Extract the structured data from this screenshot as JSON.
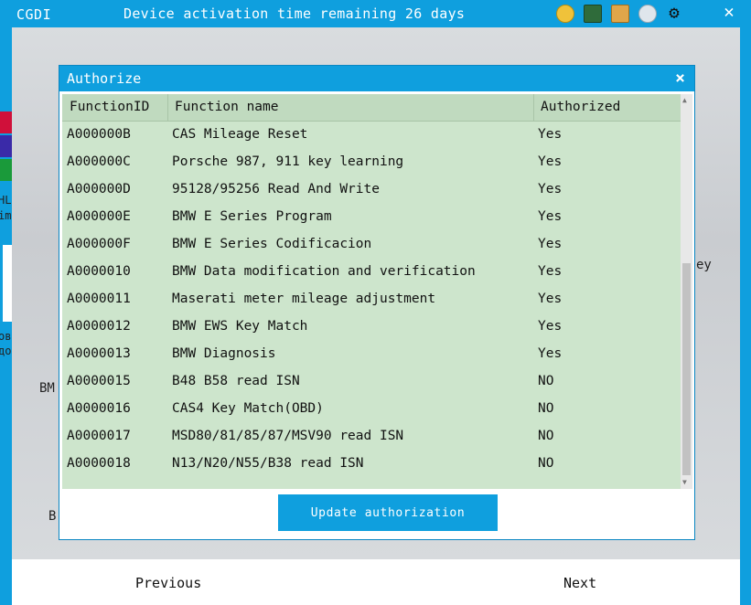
{
  "app": {
    "title": "CGDI",
    "activation_notice": "Device activation time remaining 26 days",
    "icons": [
      "coin-icon",
      "book-icon",
      "folder-icon",
      "handshake-icon",
      "gear-icon",
      "close-icon"
    ]
  },
  "background": {
    "fragments": {
      "left1": "HL",
      "left2": "im",
      "left3": "овы",
      "left4": "до",
      "bmw_fragment": "BM",
      "b_fragment": "B",
      "right_fragment": "ey"
    }
  },
  "dialog": {
    "title": "Authorize",
    "close_glyph": "×",
    "columns": [
      "FunctionID",
      "Function name",
      "Authorized"
    ],
    "rows": [
      {
        "id": "A000000B",
        "name": "CAS Mileage Reset",
        "authorized": "Yes"
      },
      {
        "id": "A000000C",
        "name": "Porsche 987, 911 key learning",
        "authorized": "Yes"
      },
      {
        "id": "A000000D",
        "name": "95128/95256 Read And Write",
        "authorized": "Yes"
      },
      {
        "id": "A000000E",
        "name": "BMW E Series Program",
        "authorized": "Yes"
      },
      {
        "id": "A000000F",
        "name": "BMW E Series Codificacion",
        "authorized": "Yes"
      },
      {
        "id": "A0000010",
        "name": "BMW Data modification and verification",
        "authorized": "Yes"
      },
      {
        "id": "A0000011",
        "name": "Maserati meter mileage adjustment",
        "authorized": "Yes"
      },
      {
        "id": "A0000012",
        "name": "BMW EWS Key Match",
        "authorized": "Yes"
      },
      {
        "id": "A0000013",
        "name": "BMW Diagnosis",
        "authorized": "Yes"
      },
      {
        "id": "A0000015",
        "name": "B48 B58 read ISN",
        "authorized": "NO"
      },
      {
        "id": "A0000016",
        "name": "CAS4 Key Match(OBD)",
        "authorized": "NO"
      },
      {
        "id": "A0000017",
        "name": "MSD80/81/85/87/MSV90 read ISN",
        "authorized": "NO"
      },
      {
        "id": "A0000018",
        "name": "N13/N20/N55/B38 read ISN",
        "authorized": "NO"
      }
    ],
    "update_button": "Update authorization"
  },
  "footer": {
    "previous": "Previous",
    "next": "Next"
  },
  "colors": {
    "accent": "#0f9fde",
    "table_bg": "#cde5cc",
    "header_bg": "#c0dabf"
  }
}
